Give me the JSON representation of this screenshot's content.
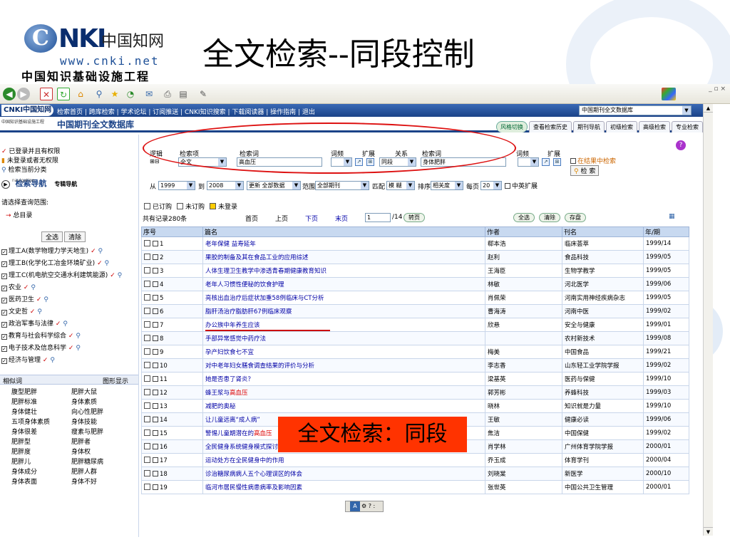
{
  "slide": {
    "logo_mark": "C",
    "logo_nki": "NKI",
    "logo_cn": "中国知网",
    "logo_url": "www.cnki.net",
    "logo_sub": "中国知识基础设施工程",
    "title": "全文检索--同段控制",
    "callout": "全文检索：同段"
  },
  "cnki_bar": {
    "logo": "CNKI中国知网",
    "nav": "检索首页 | 跨库检索 | 学术论坛 | 订阅推送 | CNKI知识搜索 | 下载阅读器 | 操作指南 | 退出",
    "db_select": "中国期刊全文数据库"
  },
  "subbar": {
    "small": "中国知识基础设施工程",
    "db_title": "中国期刊全文数据库",
    "tabs": [
      "风格切换",
      "查看检索历史",
      "期刊导航",
      "初级检索",
      "高级检索",
      "专业检索"
    ]
  },
  "left": {
    "status": [
      "已登录并且有权限",
      "未登录或者无权限",
      "检索当前分类"
    ],
    "nav_small": "navigation",
    "nav_title": "检索导航",
    "nav_journal": "专辑导航",
    "scope_label": "请选择查询范围:",
    "root": "总目录",
    "select_all": "全选",
    "clear": "清除",
    "categories": [
      "理工A(数学物理力学天地生)",
      "理工B(化学化工冶金环境矿业)",
      "理工C(机电航空交通水利建筑能源)",
      "农业",
      "医药卫生",
      "文史哲",
      "政治军事与法律",
      "教育与社会科学综合",
      "电子技术及信息科学",
      "经济与管理"
    ],
    "related_title": "相似词",
    "related_toggle": "图形显示",
    "related_words": [
      "腹型肥胖",
      "肥胖大鼠",
      "肥胖标准",
      "身体素质",
      "身体健壮",
      "向心性肥胖",
      "五项身体素质",
      "身体技能",
      "身体很差",
      "瘦素与肥胖",
      "肥胖型",
      "肥胖者",
      "肥胖度",
      "身体权",
      "肥胖儿",
      "肥胖糖尿病",
      "身体成分",
      "肥胖人群",
      "身体表面",
      "身体不好"
    ]
  },
  "search": {
    "logic_label": "逻辑",
    "item_label": "检索项",
    "term_label": "检索词",
    "freq_label": "词频",
    "expand_label": "扩展",
    "relation_label": "关系",
    "term2_label": "检索词",
    "freq2_label": "词频",
    "expand2_label": "扩展",
    "logic_btns": "⊞⊟",
    "field": "全文",
    "term1": "高血压",
    "relation": "同段",
    "term2": "身体肥胖",
    "in_results": "在结果中检索",
    "search_btn": "检 索",
    "from_label": "从",
    "from_year": "1999",
    "to_label": "到",
    "to_year": "2008",
    "update": "更新 全部数据",
    "range_label": "范围",
    "range": "全部期刊",
    "match_label": "匹配",
    "match": "模 糊",
    "sort_label": "排序",
    "sort": "相关度",
    "per_page_label": "每页",
    "per_page": "20",
    "cn_en": "中英扩展"
  },
  "listbar": {
    "legend": [
      "已订购",
      "未订购",
      "未登录"
    ],
    "total": "共有记录280条",
    "first": "首页",
    "prev": "上页",
    "next": "下页",
    "last": "末页",
    "page": "1",
    "page_total": "/14",
    "goto": "转页",
    "select_all": "全选",
    "clear": "清除",
    "save": "存盘"
  },
  "table": {
    "headers": [
      "序号",
      "篇名",
      "作者",
      "刊名",
      "年/期"
    ],
    "rows": [
      {
        "n": "1",
        "title": "老年保健 益寿延年",
        "author": "郗本浩",
        "journal": "临床荟萃",
        "issue": "1999/14"
      },
      {
        "n": "2",
        "title": "果胶的制备及其在食品工业的应用综述",
        "author": "赵利",
        "journal": "食品科技",
        "issue": "1999/05"
      },
      {
        "n": "3",
        "title": "人体生理卫生教学中渗透青春期健康教育知识",
        "author": "王海臣",
        "journal": "生物学教学",
        "issue": "1999/05"
      },
      {
        "n": "4",
        "title": "老年人习惯性便秘的饮食护理",
        "author": "林敏",
        "journal": "河北医学",
        "issue": "1999/06"
      },
      {
        "n": "5",
        "title": "亮核出血治疗后症状加重58例临床与CT分析",
        "author": "肖佩荣",
        "journal": "河南实用神经疾病杂志",
        "issue": "1999/05"
      },
      {
        "n": "6",
        "title": "脂肝汤治疗脂肪肝67例临床观察",
        "author": "曹海涛",
        "journal": "河南中医",
        "issue": "1999/02"
      },
      {
        "n": "7",
        "title": "办公族中年养生应该",
        "author": "欣悬",
        "journal": "安全与健康",
        "issue": "1999/01"
      },
      {
        "n": "8",
        "title": "手部异常感觉中药疗法",
        "author": "",
        "journal": "农村新技术",
        "issue": "1999/08"
      },
      {
        "n": "9",
        "title": "孕产妇饮食七不宜",
        "author": "梅美",
        "journal": "中国食品",
        "issue": "1999/21"
      },
      {
        "n": "10",
        "title": "对中老年妇女膳食调查结果的评价与分析",
        "author": "李志香",
        "journal": "山东轻工业学院学报",
        "issue": "1999/02"
      },
      {
        "n": "11",
        "title": "她是否患了肾炎？",
        "author": "梁基英",
        "journal": "医药与保健",
        "issue": "1999/10"
      },
      {
        "n": "12",
        "title": "蜂王浆与高血压",
        "author": "郭芳彬",
        "journal": "养蜂科技",
        "issue": "1999/03"
      },
      {
        "n": "13",
        "title": "减肥的奥秘",
        "author": "晓林",
        "journal": "知识就是力量",
        "issue": "1999/10"
      },
      {
        "n": "14",
        "title": "让儿童远离“成人病”",
        "author": "王敏",
        "journal": "健康必读",
        "issue": "1999/06"
      },
      {
        "n": "15",
        "title": "警惕儿童期潜在的高血压",
        "author": "焦洁",
        "journal": "中国保健",
        "issue": "1999/02"
      },
      {
        "n": "16",
        "title": "全民健身系统健身模式探讨",
        "author": "肖学林",
        "journal": "广州体育学院学报",
        "issue": "2000/01"
      },
      {
        "n": "17",
        "title": "运动处方在全民健身中的作用",
        "author": "乔玉成",
        "journal": "体育学刊",
        "issue": "2000/04"
      },
      {
        "n": "18",
        "title": "诊治糖尿病病人五个心理误区的体会",
        "author": "刘晓棠",
        "journal": "新医学",
        "issue": "2000/10"
      },
      {
        "n": "19",
        "title": "临河市居民慢性病患病率及影响因素",
        "author": "张世英",
        "journal": "中国公共卫生管理",
        "issue": "2000/01"
      }
    ]
  },
  "float_toolbar": "⚙ ? :"
}
